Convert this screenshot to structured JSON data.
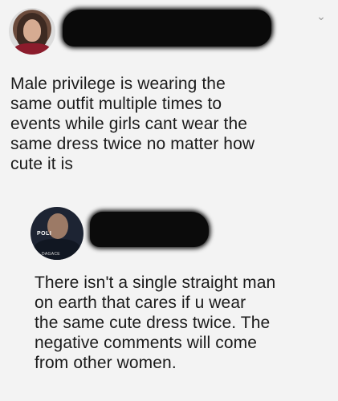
{
  "post1": {
    "text": "Male privilege is wearing the\nsame outfit multiple times to\nevents while girls cant wear the\nsame dress twice  no matter how\ncute it is"
  },
  "post2": {
    "avatar_tags": [
      "POLI",
      "DAGACE"
    ],
    "text": "There isn't a single straight man\non earth that cares if u wear\nthe same cute dress twice. The\nnegative comments will come\nfrom other women."
  },
  "icons": {
    "menu_chevron": "chevron-down-icon"
  },
  "colors": {
    "background": "#f3f3f3",
    "text": "#1b1b1b",
    "redaction": "#0a0a0a"
  }
}
